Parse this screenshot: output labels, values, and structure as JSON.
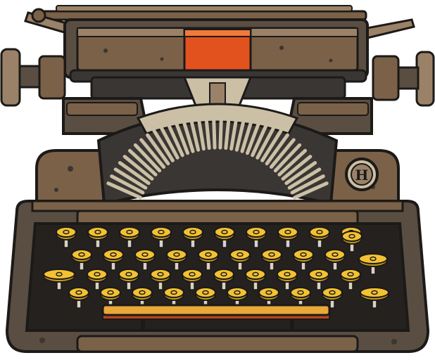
{
  "illustration": {
    "subject": "vintage-typewriter",
    "badge_glyph": "H",
    "key_glyphs": [
      [
        "",
        "",
        "",
        "",
        "",
        "",
        "",
        "",
        "",
        ""
      ],
      [
        "",
        "",
        "",
        "",
        "",
        "",
        "",
        "",
        ""
      ],
      [
        "",
        "",
        "",
        "",
        "",
        "",
        "",
        "",
        ""
      ],
      [
        "",
        "",
        "",
        "",
        "",
        "",
        "",
        "",
        ""
      ]
    ]
  },
  "colors": {
    "outline": "#1c1a18",
    "body_dark": "#3a3633",
    "body_mid": "#5a4e42",
    "body_brown": "#7a6148",
    "body_light": "#9a8268",
    "paper_plate": "#e2521f",
    "key_yellow": "#f2c233",
    "key_shadow": "#c79a1e",
    "key_stem": "#d8d2c4",
    "type_bar": "#cbbfa6",
    "spacebar": "#e8a83a",
    "spacebar_base": "#b8441c"
  }
}
